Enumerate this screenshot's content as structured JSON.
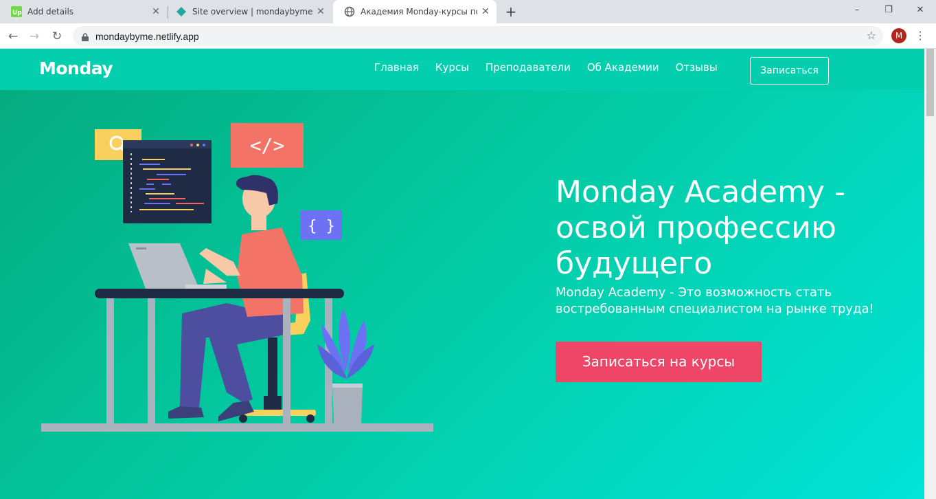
{
  "browser": {
    "tabs": [
      {
        "title": "Add details",
        "favicon": "upwork-icon"
      },
      {
        "title": "Site overview | mondaybyme",
        "favicon": "netlify-icon"
      },
      {
        "title": "Академия Monday-курсы по пр",
        "favicon": "globe-icon"
      }
    ],
    "active_tab": 2,
    "url": "mondaybyme.netlify.app",
    "avatar_letter": "M",
    "avatar_color": "#b3261e"
  },
  "site": {
    "logo": "Monday",
    "nav": [
      "Главная",
      "Курсы",
      "Преподаватели",
      "Об Академии",
      "Отзывы"
    ],
    "signup_label": "Записаться"
  },
  "hero": {
    "title": "Monday Academy - освой профессию будущего",
    "subtitle": "Monday Academy - Это возможность стать востребованным специалистом на рынке труда!",
    "cta_label": "Записаться на курсы",
    "illustration": {
      "code_tag": "</>",
      "braces": "{ }"
    }
  },
  "colors": {
    "header": "#03cfae",
    "cta": "#ef4567",
    "gradient_start": "#05a97d",
    "gradient_end": "#02e4d8"
  }
}
